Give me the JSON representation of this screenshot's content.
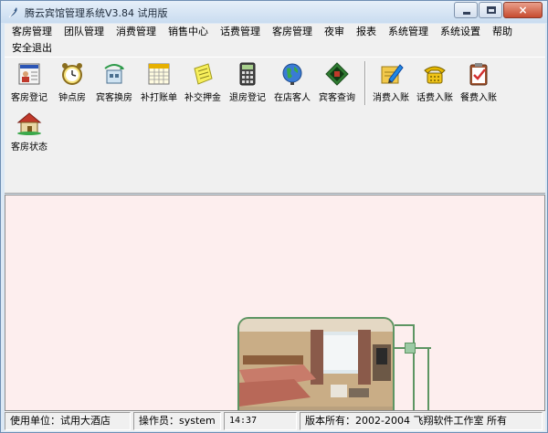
{
  "window": {
    "title": "腾云宾馆管理系统V3.84 试用版",
    "controls": {
      "close": "×"
    }
  },
  "menu": {
    "row1": [
      "客房管理",
      "团队管理",
      "消费管理",
      "销售中心",
      "话费管理",
      "客房管理",
      "夜审",
      "报表",
      "系统管理",
      "系统设置",
      "帮助"
    ],
    "row2": [
      "安全退出"
    ]
  },
  "toolbar": {
    "group1": [
      {
        "label": "客房登记",
        "icon": "guest-register-icon"
      },
      {
        "label": "钟点房",
        "icon": "alarm-clock-icon"
      },
      {
        "label": "宾客换房",
        "icon": "room-change-icon"
      },
      {
        "label": "补打账单",
        "icon": "calendar-bill-icon"
      },
      {
        "label": "补交押金",
        "icon": "sticky-note-icon"
      },
      {
        "label": "退房登记",
        "icon": "calculator-icon"
      },
      {
        "label": "在店客人",
        "icon": "globe-guest-icon"
      },
      {
        "label": "宾客查询",
        "icon": "book-search-icon"
      }
    ],
    "group2": [
      {
        "label": "消费入账",
        "icon": "pencil-ledger-icon"
      },
      {
        "label": "话费入账",
        "icon": "telephone-icon"
      },
      {
        "label": "餐费入账",
        "icon": "clipboard-check-icon"
      }
    ],
    "row2": [
      {
        "label": "客房状态",
        "icon": "house-icon"
      }
    ]
  },
  "statusbar": {
    "unit": "使用单位：试用大酒店",
    "operator": "操作员：system",
    "time": "14:37",
    "copyright": "版本所有：2002-2004 飞翔软件工作室 所有"
  },
  "colors": {
    "workspace_bg": "#fdeeee",
    "decor_green": "#5d9563",
    "toolbar_bg": "#f0f0f0"
  }
}
